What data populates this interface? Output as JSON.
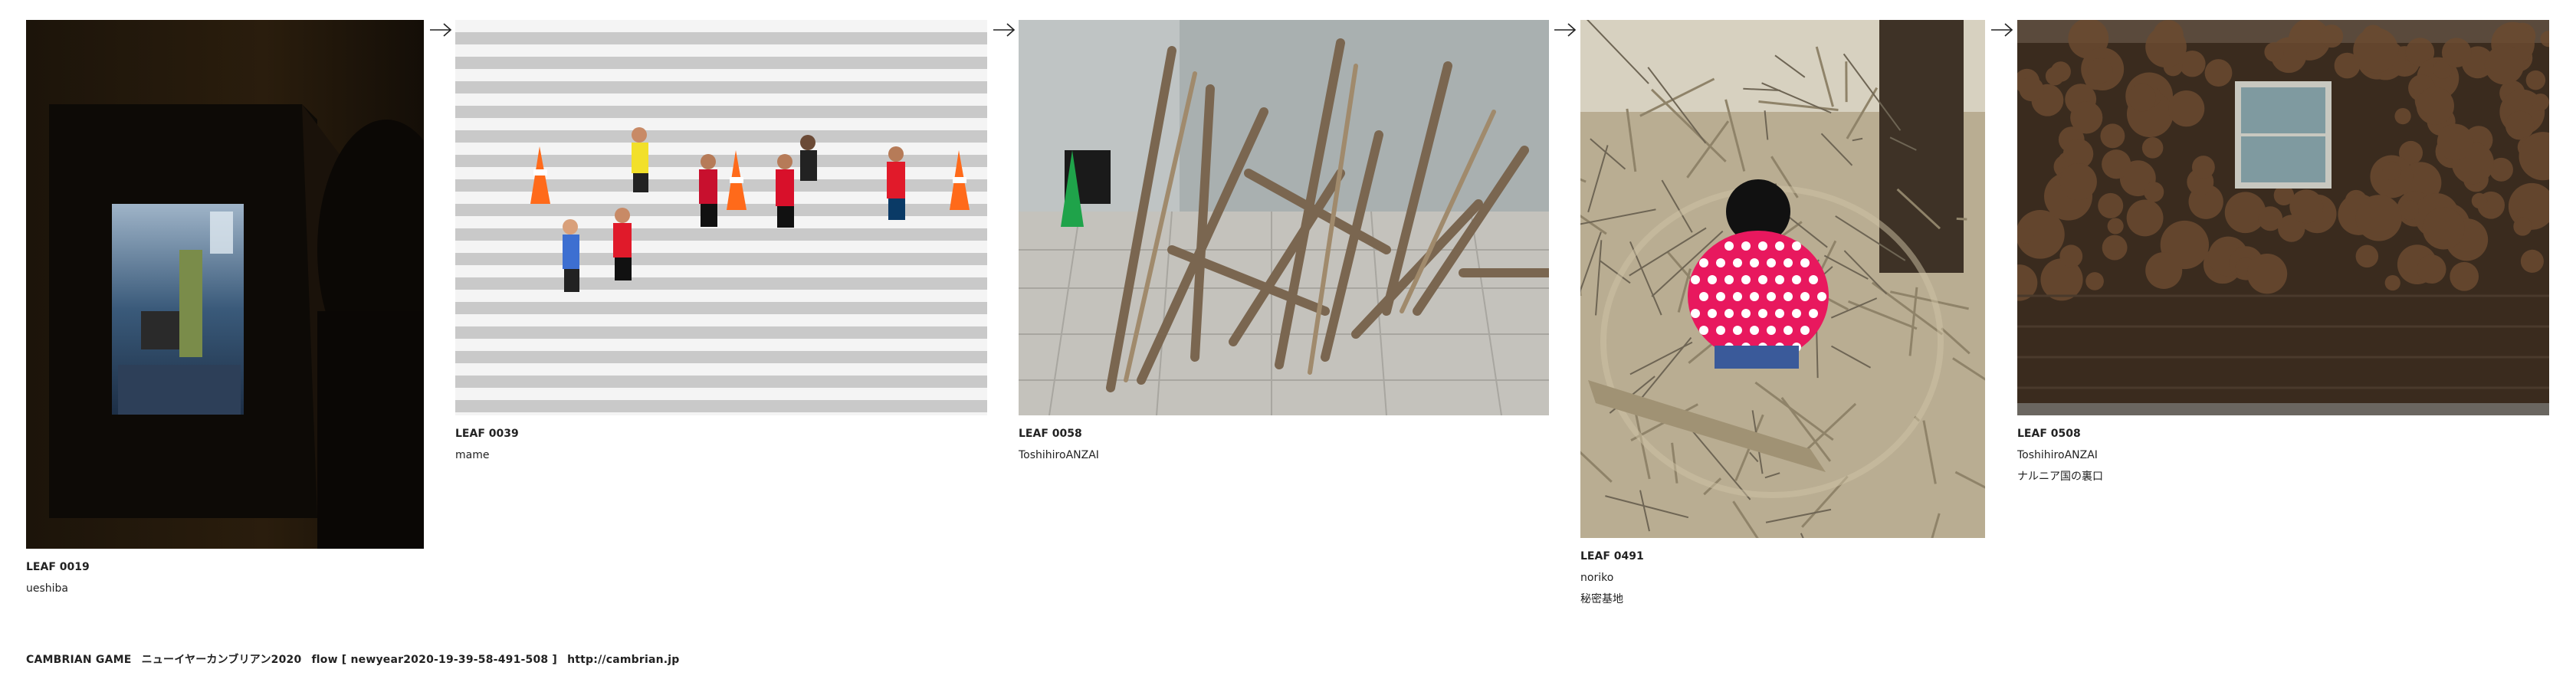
{
  "leaves": [
    {
      "number": "LEAF 0019",
      "author": "ueshiba",
      "title": ""
    },
    {
      "number": "LEAF 0039",
      "author": "mame",
      "title": ""
    },
    {
      "number": "LEAF 0058",
      "author": "ToshihiroANZAI",
      "title": ""
    },
    {
      "number": "LEAF 0491",
      "author": "noriko",
      "title": "秘密基地"
    },
    {
      "number": "LEAF 0508",
      "author": "ToshihiroANZAI",
      "title": "ナルニア国の裏口"
    }
  ],
  "footer": {
    "game": "CAMBRIAN GAME",
    "title": "ニューイヤーカンブリアン2020",
    "flow": "flow [ newyear2020-19-39-58-491-508 ]",
    "link": "http://cambrian.jp"
  },
  "icons": {
    "arrow": "right-arrow-icon"
  },
  "colors": {
    "background": "#ffffff",
    "text": "#222222",
    "polka_dot_jacket": "#e8185e"
  }
}
